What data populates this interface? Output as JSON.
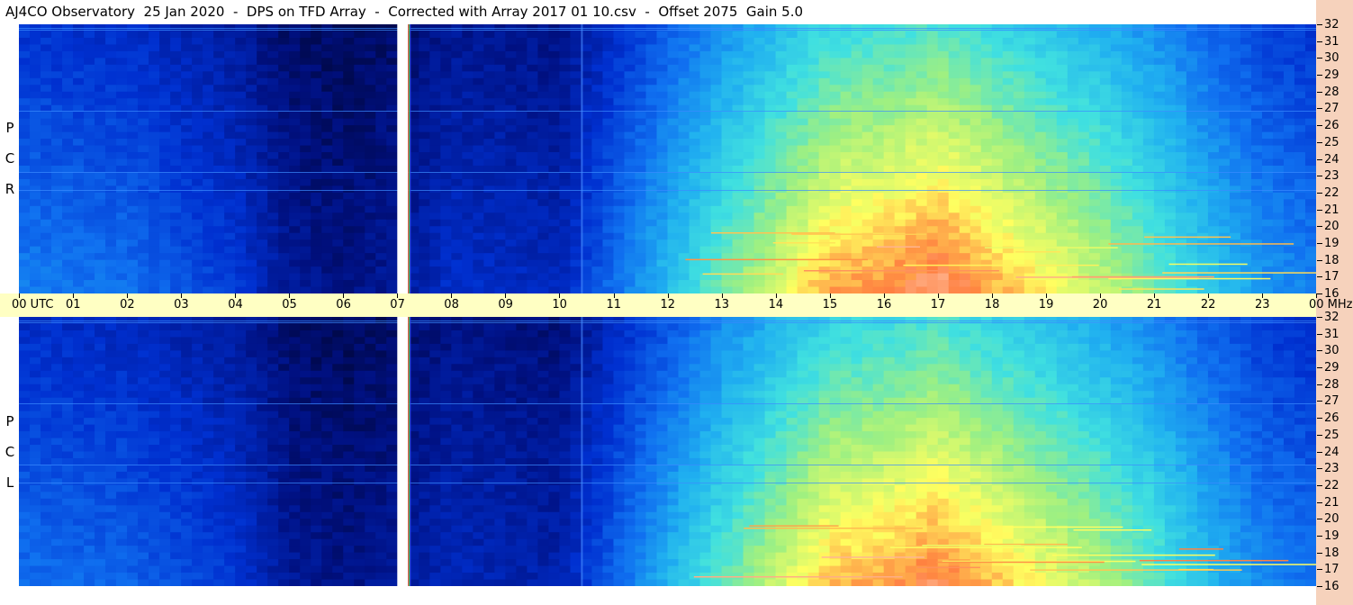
{
  "title": "AJ4CO Observatory  25 Jan 2020  -  DPS on TFD Array  -  Corrected with Array 2017 01 10.csv  -  Offset 2075  Gain 5.0",
  "chart_data": [
    {
      "type": "heatmap",
      "panel": "top",
      "polarization_label": [
        "R",
        "C",
        "P"
      ],
      "x_axis": {
        "unit": "UTC",
        "range": [
          0,
          24
        ],
        "tick_labels": [
          "00",
          "01",
          "02",
          "03",
          "04",
          "05",
          "06",
          "07",
          "08",
          "09",
          "10",
          "11",
          "12",
          "13",
          "14",
          "15",
          "16",
          "17",
          "18",
          "19",
          "20",
          "21",
          "22",
          "23",
          "00"
        ],
        "first_label_suffix": "UTC"
      },
      "y_axis": {
        "unit": "MHz",
        "range": [
          16,
          32
        ],
        "tick_labels": [
          "16",
          "17",
          "18",
          "19",
          "20",
          "21",
          "22",
          "23",
          "24",
          "25",
          "26",
          "27",
          "28",
          "29",
          "30",
          "31",
          "32"
        ],
        "side": "right"
      },
      "data_gap_utc": [
        7.0,
        7.2
      ],
      "intensity_profile": {
        "hours": [
          0,
          2,
          4,
          5,
          6,
          7,
          8,
          10,
          11,
          12,
          13,
          14,
          15,
          16,
          17,
          18,
          19,
          20,
          21,
          22,
          23,
          24
        ],
        "level": [
          0.3,
          0.28,
          0.2,
          0.12,
          0.1,
          0.12,
          0.18,
          0.16,
          0.28,
          0.4,
          0.52,
          0.62,
          0.72,
          0.74,
          0.78,
          0.72,
          0.66,
          0.6,
          0.52,
          0.42,
          0.34,
          0.3
        ]
      },
      "colormap": [
        "#000010",
        "#001080",
        "#0030d0",
        "#1070f0",
        "#20b0f0",
        "#40e0e0",
        "#a0f080",
        "#ffff60",
        "#ff8040",
        "#ffffff"
      ]
    },
    {
      "type": "heatmap",
      "panel": "bottom",
      "polarization_label": [
        "L",
        "C",
        "P"
      ],
      "x_axis": {
        "unit": "UTC",
        "range": [
          0,
          24
        ]
      },
      "y_axis": {
        "unit": "MHz",
        "range": [
          16,
          32
        ],
        "tick_labels": [
          "16",
          "17",
          "18",
          "19",
          "20",
          "21",
          "22",
          "23",
          "24",
          "25",
          "26",
          "27",
          "28",
          "29",
          "30",
          "31",
          "32"
        ],
        "side": "right"
      },
      "data_gap_utc": [
        7.0,
        7.2
      ],
      "intensity_profile": {
        "hours": [
          0,
          2,
          4,
          5,
          6,
          7,
          8,
          10,
          11,
          12,
          13,
          14,
          15,
          16,
          17,
          18,
          19,
          20,
          21,
          22,
          23,
          24
        ],
        "level": [
          0.28,
          0.26,
          0.2,
          0.12,
          0.1,
          0.12,
          0.16,
          0.14,
          0.26,
          0.38,
          0.5,
          0.6,
          0.7,
          0.72,
          0.76,
          0.7,
          0.64,
          0.58,
          0.5,
          0.4,
          0.32,
          0.28
        ]
      }
    }
  ],
  "mhz_label": "MHz"
}
